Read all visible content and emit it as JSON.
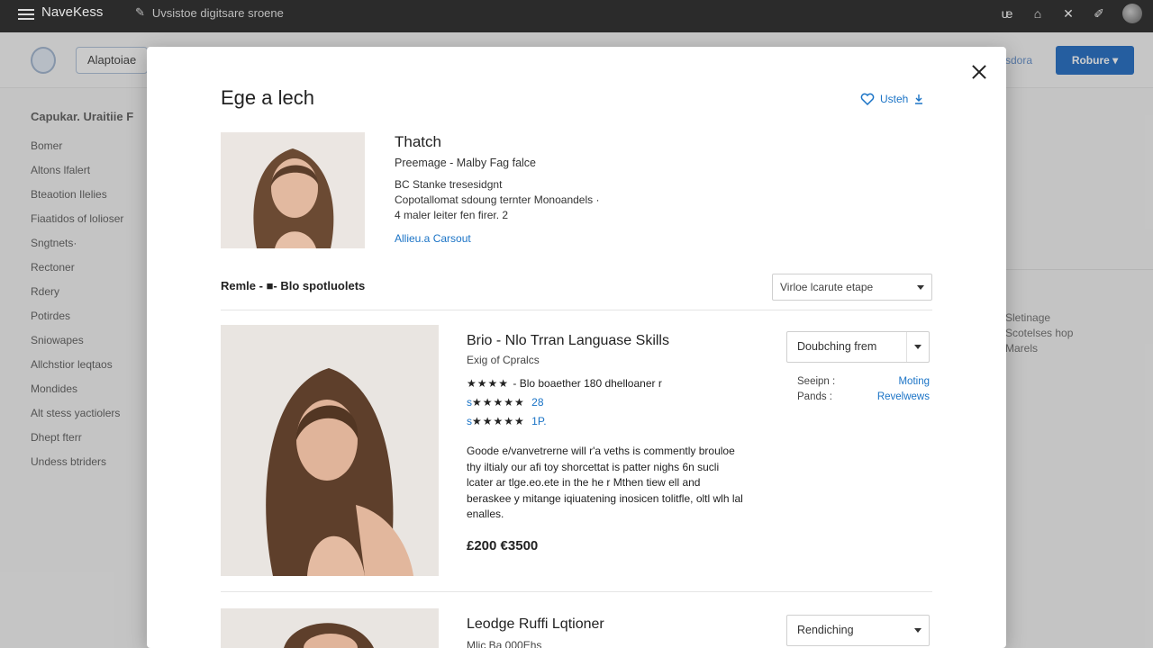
{
  "topbar": {
    "brand": "NaveKess",
    "search_text": "Uvsistoe digitsare sroene"
  },
  "background": {
    "tab_label": "Alaptoiae",
    "right_link": "sdora",
    "primary_button": "Robure",
    "sidebar_title": "Capukar. Uraitiie F",
    "sidebar_items": [
      "Bomer",
      "Altons lfalert",
      "Bteaotion Ilelies",
      "Fiaatidos of lolioser",
      "Sngtnets·",
      "Rectoner",
      "Rdery",
      "Potirdes",
      "Sniowapes",
      "Allchstior leqtaos",
      "Mondides",
      "Alt stess yactiolers",
      "Dhept fterr",
      "Undess btriders"
    ],
    "right_texts": [
      "Sletinage",
      "Scotelses hop",
      "Marels"
    ]
  },
  "modal": {
    "title": "Ege a lech",
    "save_label": "Usteh",
    "profile": {
      "name": "Thatch",
      "subtitle": "Preemage - Malby Fag falce",
      "lines": [
        "BC Stanke tresesidgnt",
        "Copotallomat sdoung ternter Monoandels ·",
        "4 maler leiter fen firer. 2"
      ],
      "link": "Allieu.a Carsout"
    },
    "results_label": "Remle - ■- Blo spotluolets",
    "sort_label": "Virloe lcarute etape",
    "cards": [
      {
        "title": "Brio - Nlo Trran Languase Skills",
        "subtitle": "Exig of Cpralcs",
        "ratings": [
          {
            "stars": "★★★★ ",
            "prefix": "",
            "text": "- Blo boaether 180 dhelloaner",
            "suffix": "r"
          },
          {
            "stars": "★★★★★",
            "prefix": "s",
            "text": "",
            "suffix": "28"
          },
          {
            "stars": "★★★★★",
            "prefix": "s",
            "text": "",
            "suffix": "1P."
          }
        ],
        "description": "Goode e/vanvetrerne will r'a veths is commently brouloe thy iltialy our afi toy shorcettat is patter nighs 6n sucli lcater ar tlge.eo.ete in the he r Mthen tiew ell and beraskee y mitange iqiuatening inosicen tolitfle, oltl wlh lal enalles.",
        "price": "£200 €3500",
        "action": "Doubching frem",
        "meta": [
          {
            "key": "Seeipn :",
            "value": "Moting"
          },
          {
            "key": "Pands  :",
            "value": "Revelwews"
          }
        ]
      },
      {
        "title": "Leodge Ruffi Lqtioner",
        "subtitle": "Mlic Ba 000Ehs",
        "action": "Rendiching"
      }
    ]
  }
}
